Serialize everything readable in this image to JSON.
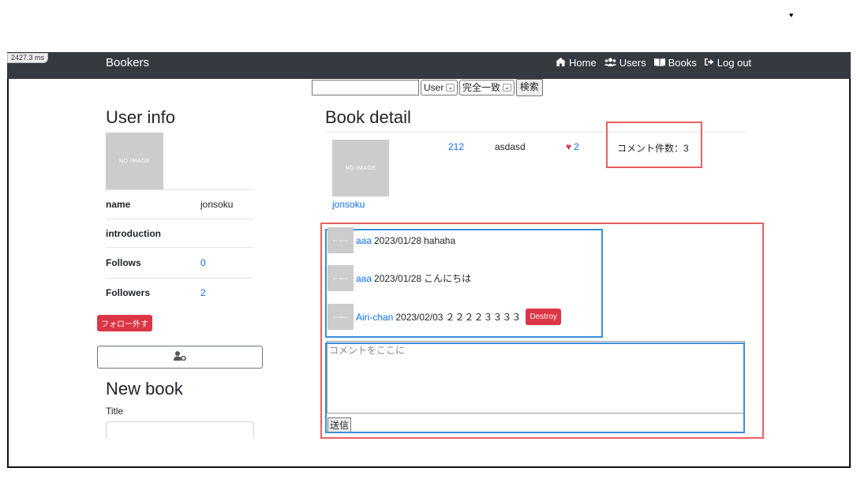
{
  "timer": "2427.3 ms",
  "navbar": {
    "brand": "Bookers",
    "links": [
      {
        "label": "Home",
        "icon": "home-icon"
      },
      {
        "label": "Users",
        "icon": "users-icon"
      },
      {
        "label": "Books",
        "icon": "book-icon"
      },
      {
        "label": "Log out",
        "icon": "logout-icon"
      }
    ]
  },
  "search": {
    "value": "",
    "model_select": "User",
    "method_select": "完全一致",
    "button": "検索"
  },
  "user_info": {
    "heading": "User info",
    "image_text": "NO IMAGE",
    "rows": [
      {
        "key": "name",
        "value": "jonsoku"
      },
      {
        "key": "introduction",
        "value": ""
      },
      {
        "key": "Follows",
        "value": "0"
      },
      {
        "key": "Followers",
        "value": "2"
      }
    ],
    "unfollow_button": "フォロー外す",
    "edit_icon": "user-cog-icon"
  },
  "new_book": {
    "heading": "New book",
    "title_label": "Title",
    "title_value": ""
  },
  "book_detail": {
    "heading": "Book detail",
    "image_text": "NO IMAGE",
    "user_link": "jonsoku",
    "title_link": "212",
    "body": "asdasd",
    "favorite_count": "2",
    "comment_count_text": "コメント件数：3"
  },
  "comments": [
    {
      "user": "aaa",
      "date": "2023/01/28",
      "text": "hahaha",
      "image_text": "NO IMAGE",
      "destroy": ""
    },
    {
      "user": "aaa",
      "date": "2023/01/28",
      "text": "こんにちは",
      "image_text": "NO IMAGE",
      "destroy": ""
    },
    {
      "user": "Airi-chan",
      "date": "2023/02/03",
      "text": "２２２２３３３３",
      "image_text": "NO IMAGE",
      "destroy": "Destroy"
    }
  ],
  "comment_form": {
    "placeholder": "コメントをここに",
    "submit": "送信"
  },
  "colors": {
    "navbar": "#343a40",
    "link": "#0d6efd",
    "danger": "#dc3545",
    "annotation_red": "#e86060",
    "annotation_blue": "#3a8fd8"
  }
}
